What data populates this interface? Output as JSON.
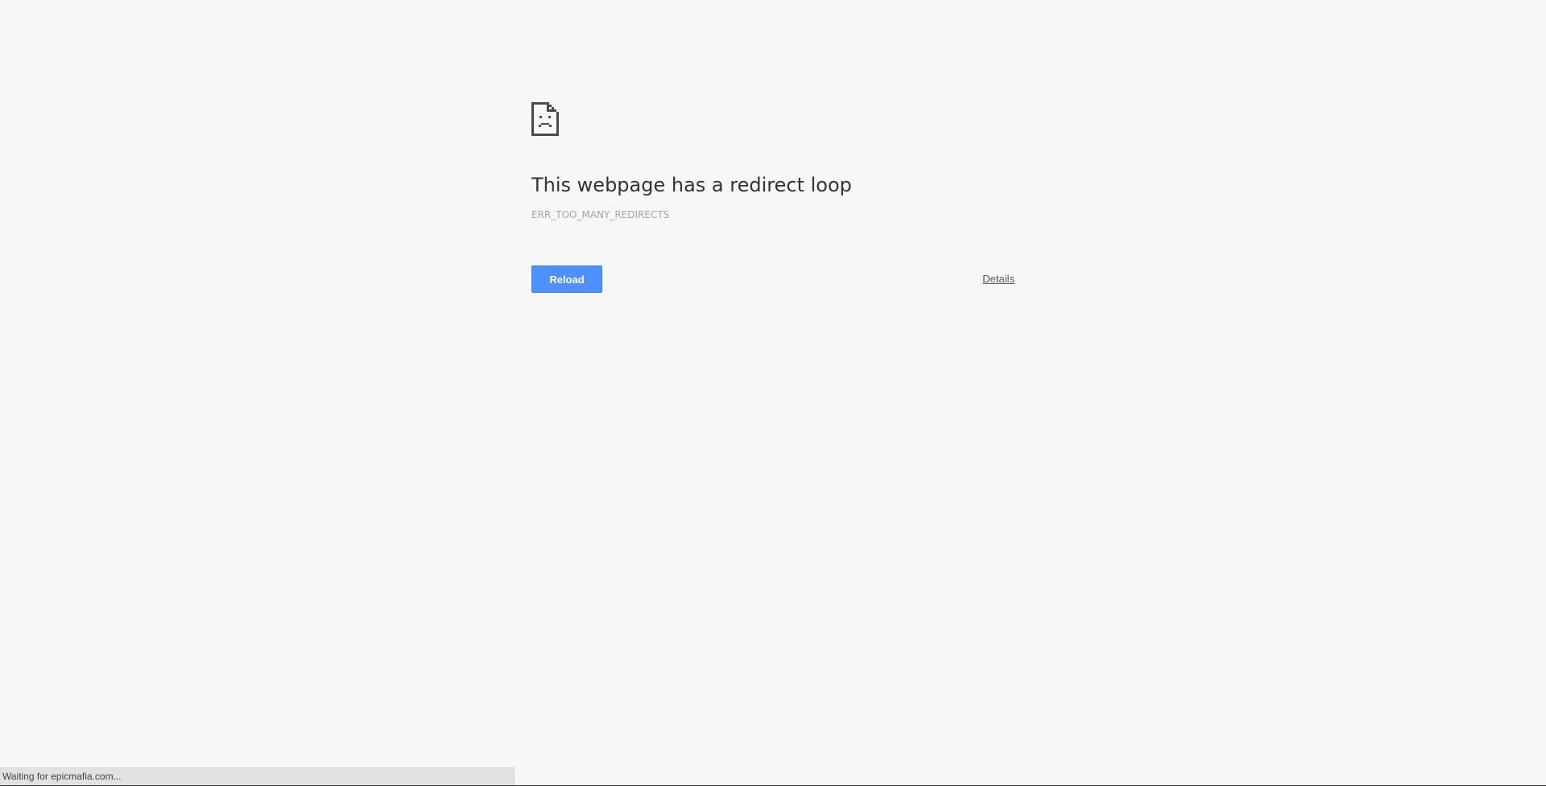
{
  "error": {
    "title": "This webpage has a redirect loop",
    "code": "ERR_TOO_MANY_REDIRECTS"
  },
  "buttons": {
    "reload_label": "Reload",
    "details_label": "Details"
  },
  "status_bar": {
    "text": "Waiting for epicmafia.com..."
  },
  "icons": {
    "error_icon": "sad-document-icon"
  },
  "colors": {
    "background": "#f7f7f7",
    "primary_button": "#4d90fe",
    "title_text": "#333333",
    "code_text": "#a6a6a6"
  }
}
